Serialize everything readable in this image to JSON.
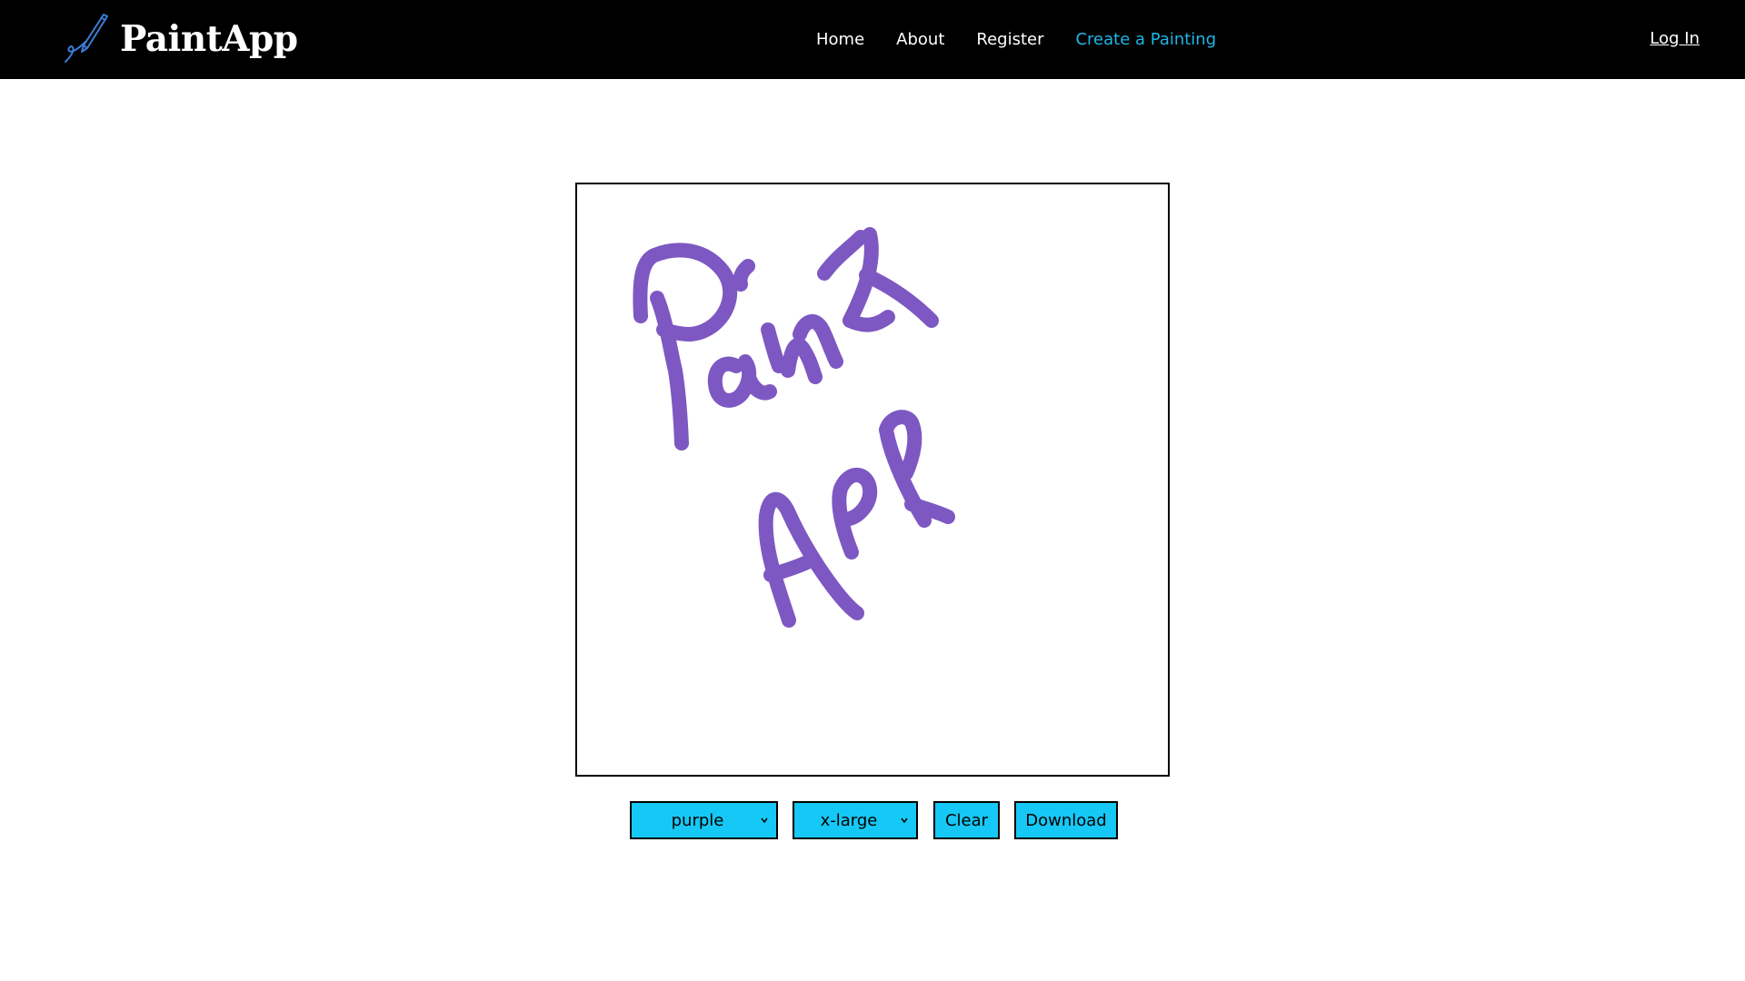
{
  "navbar": {
    "brand_name": "PaintApp",
    "brand_icon": "pen-stroke-icon",
    "links": [
      {
        "label": "Home",
        "active": false
      },
      {
        "label": "About",
        "active": false
      },
      {
        "label": "Register",
        "active": false
      },
      {
        "label": "Create a Painting",
        "active": true
      }
    ],
    "login_label": "Log In"
  },
  "canvas": {
    "stroke_color": "#7d58c2",
    "drawing_text": [
      "Paint",
      "App"
    ]
  },
  "controls": {
    "color_select": {
      "value": "purple"
    },
    "size_select": {
      "value": "x-large"
    },
    "clear_label": "Clear",
    "download_label": "Download"
  },
  "colors": {
    "navbar_bg": "#000000",
    "active_link": "#1fb6e6",
    "control_bg": "#16c8f5"
  }
}
